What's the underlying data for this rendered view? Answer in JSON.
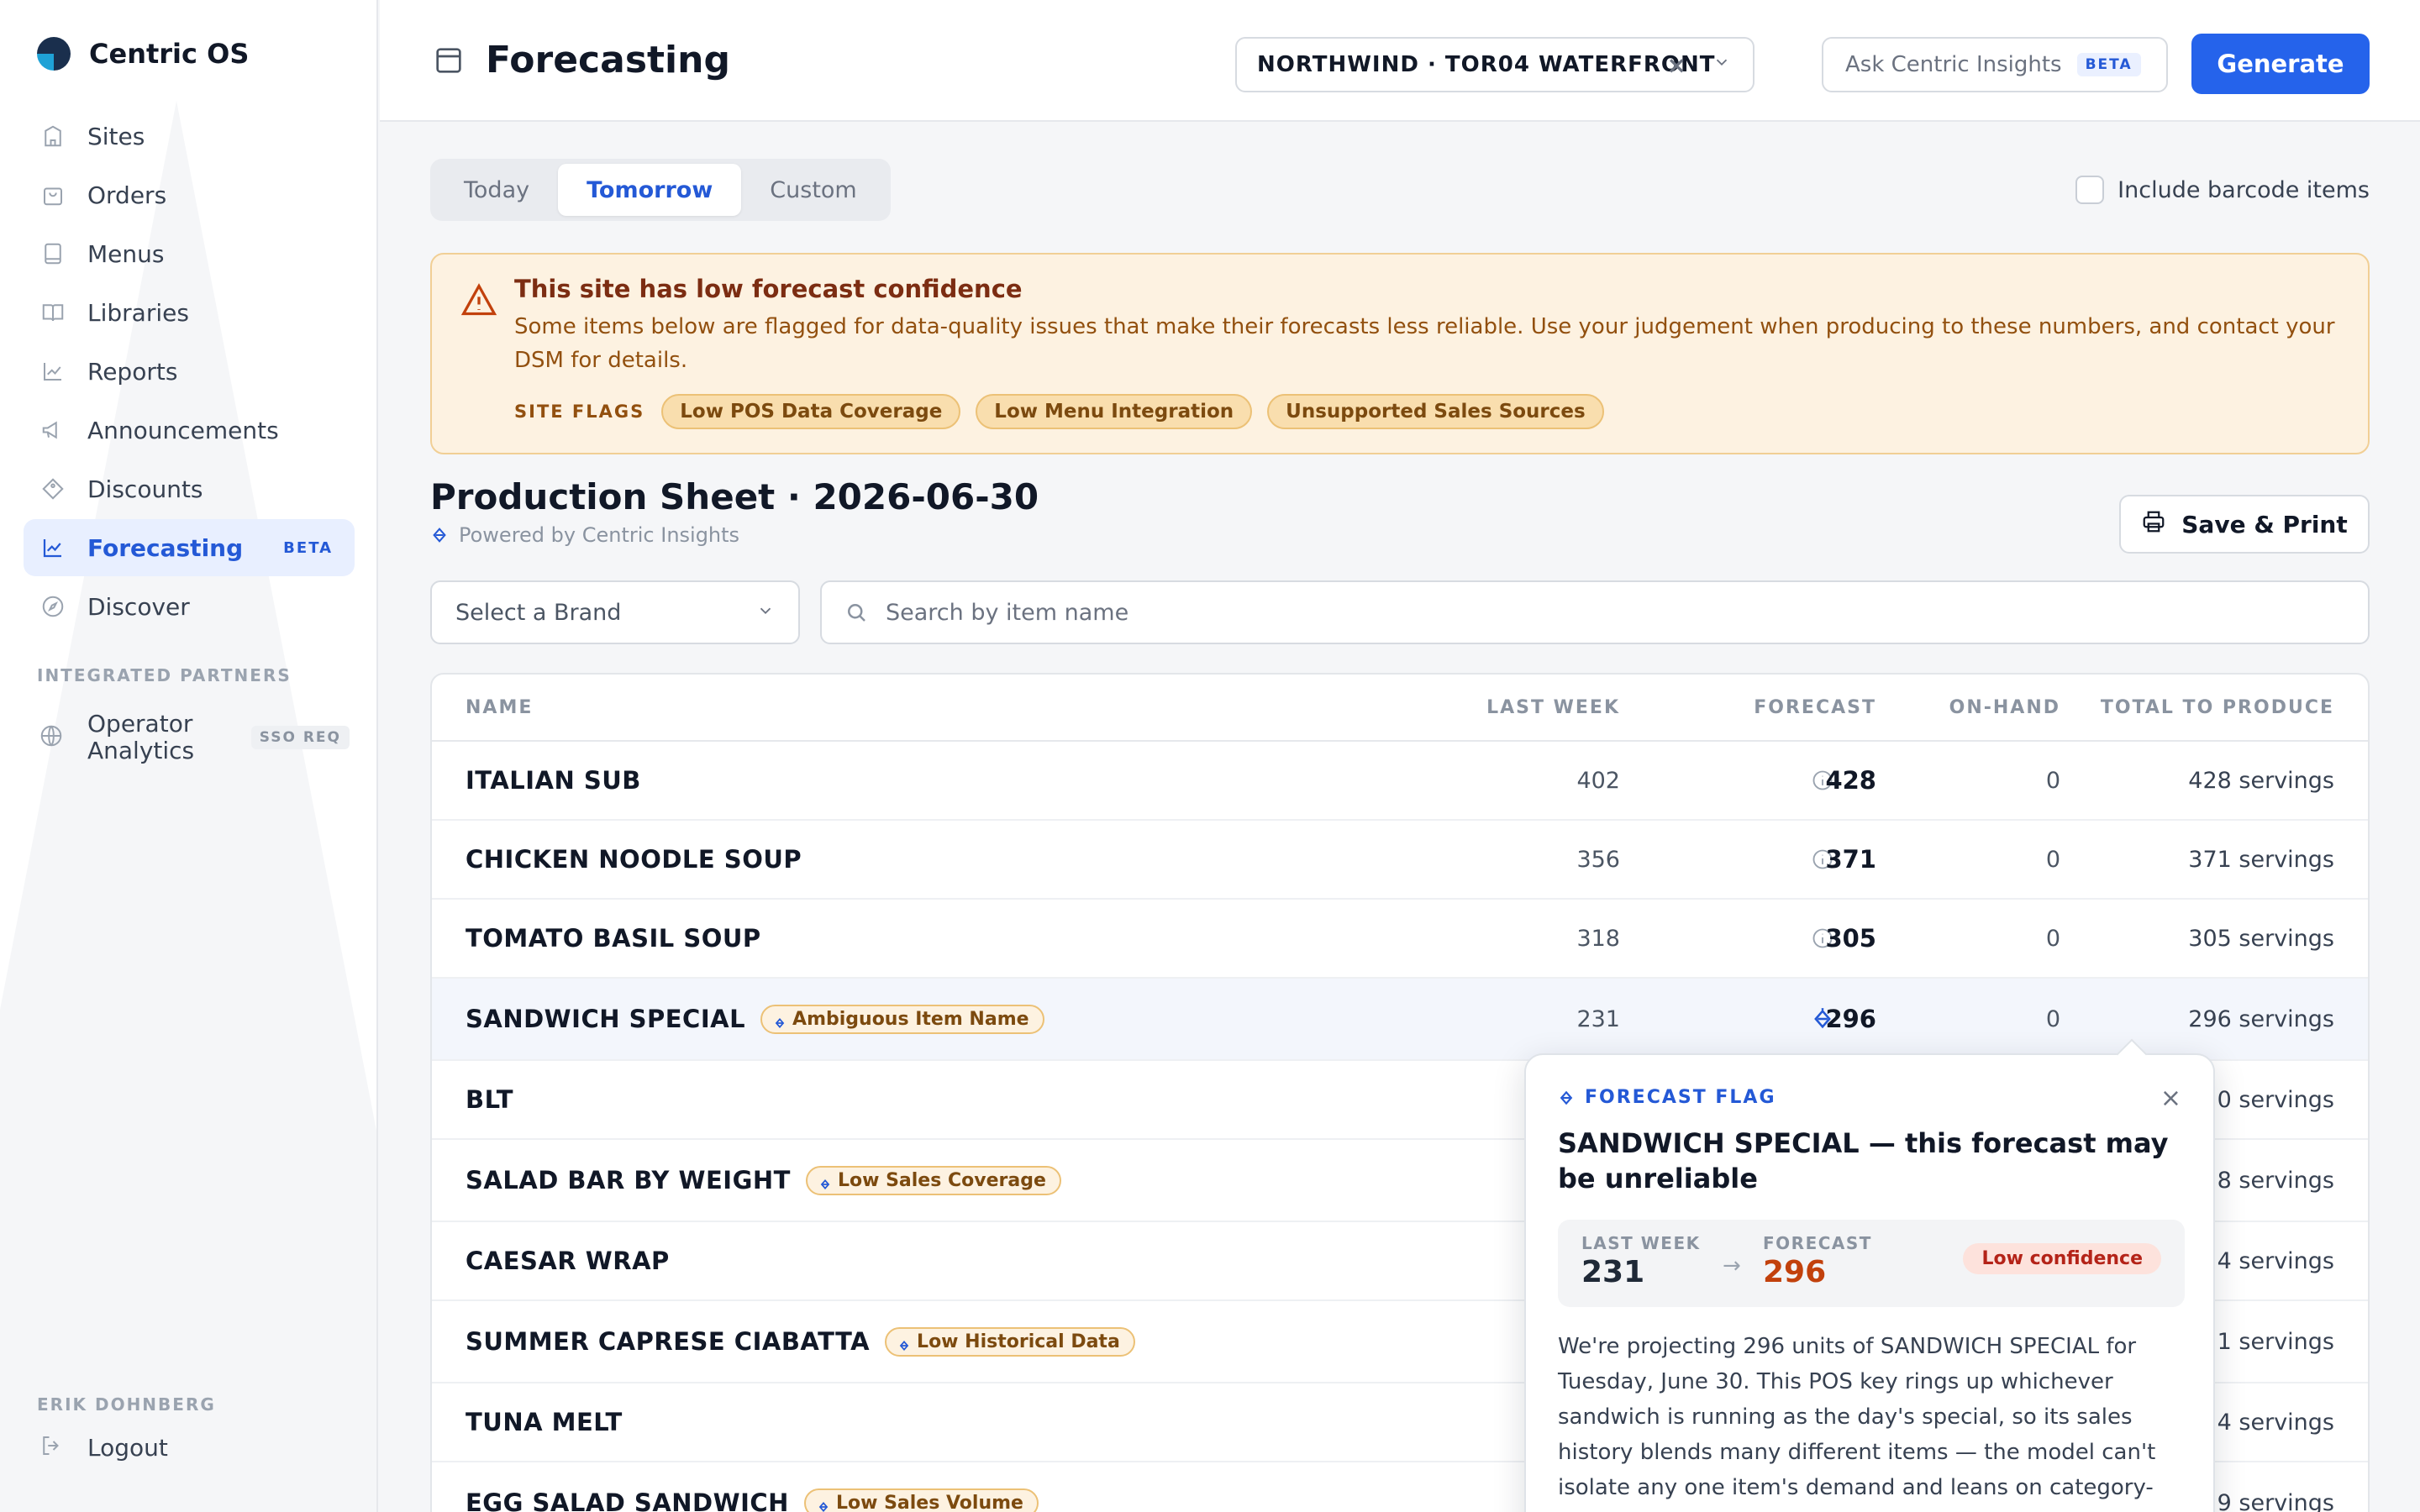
{
  "app": {
    "name": "Centric OS"
  },
  "sidebar": {
    "items": [
      {
        "label": "Sites",
        "icon": "building-icon"
      },
      {
        "label": "Orders",
        "icon": "bag-icon"
      },
      {
        "label": "Menus",
        "icon": "book-icon"
      },
      {
        "label": "Libraries",
        "icon": "open-book-icon"
      },
      {
        "label": "Reports",
        "icon": "chart-icon"
      },
      {
        "label": "Announcements",
        "icon": "megaphone-icon"
      },
      {
        "label": "Discounts",
        "icon": "tag-icon"
      },
      {
        "label": "Forecasting",
        "icon": "trend-icon",
        "badge": "BETA",
        "active": true
      },
      {
        "label": "Discover",
        "icon": "compass-icon"
      }
    ],
    "partners_label": "INTEGRATED PARTNERS",
    "partner": {
      "label": "Operator Analytics",
      "badge": "SSO REQ"
    },
    "user_label": "ERIK DOHNBERG",
    "logout_label": "Logout"
  },
  "header": {
    "title": "Forecasting",
    "site_select": "NORTHWIND · TOR04 WATERFRONT",
    "ask_placeholder": "Ask Centric Insights",
    "ask_badge": "BETA",
    "generate_label": "Generate"
  },
  "day_tabs": [
    "Today",
    "Tomorrow",
    "Custom"
  ],
  "active_day_tab": "Tomorrow",
  "barcode_label": "Include barcode items",
  "alert": {
    "title": "This site has low forecast confidence",
    "body": "Some items below are flagged for data-quality issues that make their forecasts less reliable. Use your judgement when producing to these numbers, and contact your DSM for details.",
    "flags_label": "SITE FLAGS",
    "flags": [
      "Low POS Data Coverage",
      "Low Menu Integration",
      "Unsupported Sales Sources"
    ]
  },
  "sheet": {
    "title": "Production Sheet · 2026-06-30",
    "powered_by": "Powered by Centric Insights",
    "print_label": "Save & Print",
    "brand_placeholder": "Select a Brand",
    "search_placeholder": "Search by item name"
  },
  "table": {
    "headers": {
      "name": "NAME",
      "last_week": "LAST WEEK",
      "forecast": "FORECAST",
      "on_hand": "ON-HAND",
      "total": "TOTAL TO PRODUCE"
    },
    "rows": [
      {
        "name": "ITALIAN SUB",
        "last_week": "402",
        "forecast": "428",
        "on_hand": "0",
        "total": "428 servings"
      },
      {
        "name": "CHICKEN NOODLE SOUP",
        "last_week": "356",
        "forecast": "371",
        "on_hand": "0",
        "total": "371 servings"
      },
      {
        "name": "TOMATO BASIL SOUP",
        "last_week": "318",
        "forecast": "305",
        "on_hand": "0",
        "total": "305 servings"
      },
      {
        "name": "SANDWICH SPECIAL",
        "tag": "Ambiguous Item Name",
        "last_week": "231",
        "forecast": "296",
        "on_hand": "0",
        "total": "296 servings"
      },
      {
        "name": "BLT",
        "total": "0 servings"
      },
      {
        "name": "SALAD BAR BY WEIGHT",
        "tag": "Low Sales Coverage",
        "total": "8 servings"
      },
      {
        "name": "CAESAR WRAP",
        "total": "4 servings"
      },
      {
        "name": "SUMMER CAPRESE CIABATTA",
        "tag": "Low Historical Data",
        "total": "1 servings"
      },
      {
        "name": "TUNA MELT",
        "total": "4 servings"
      },
      {
        "name": "EGG SALAD SANDWICH",
        "tag": "Low Sales Volume",
        "total": "9 servings"
      }
    ]
  },
  "popover": {
    "kicker": "FORECAST FLAG",
    "title": "SANDWICH SPECIAL — this forecast may be unreliable",
    "last_week_label": "LAST WEEK",
    "last_week_value": "231",
    "forecast_label": "FORECAST",
    "forecast_value": "296",
    "confidence": "Low confidence",
    "description": "We're projecting 296 units of SANDWICH SPECIAL for Tuesday, June 30. This POS key rings up whichever sandwich is running as the day's special, so its sales history blends many different items — the model can't isolate any one item's demand and leans on category-level patterns instead."
  },
  "colors": {
    "accent": "#2563eb",
    "warning_bg": "#fdf2e1",
    "warning_border": "#f1cf95",
    "danger": "#c2410c"
  }
}
